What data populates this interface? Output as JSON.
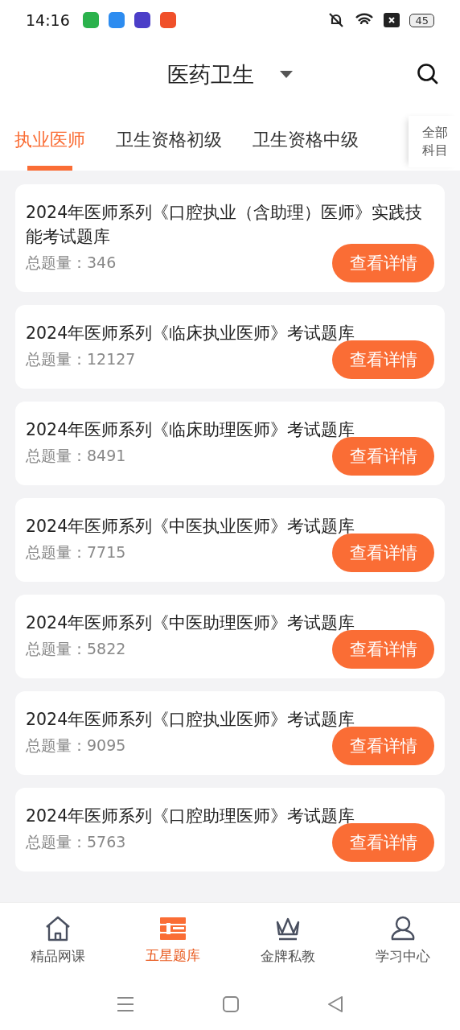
{
  "status_bar": {
    "time": "14:16",
    "battery": "45"
  },
  "header": {
    "title": "医药卫生"
  },
  "tabs": [
    {
      "label": "执业医师",
      "selected": true
    },
    {
      "label": "卫生资格初级",
      "selected": false
    },
    {
      "label": "卫生资格中级",
      "selected": false
    }
  ],
  "all_subjects": "全部科目",
  "banks": [
    {
      "title": "2024年医师系列《口腔执业（含助理）医师》实践技能考试题库",
      "count_label": "总题量：",
      "count": "346",
      "button": "查看详情"
    },
    {
      "title": "2024年医师系列《临床执业医师》考试题库",
      "count_label": "总题量：",
      "count": "12127",
      "button": "查看详情"
    },
    {
      "title": "2024年医师系列《临床助理医师》考试题库",
      "count_label": "总题量：",
      "count": "8491",
      "button": "查看详情"
    },
    {
      "title": "2024年医师系列《中医执业医师》考试题库",
      "count_label": "总题量：",
      "count": "7715",
      "button": "查看详情"
    },
    {
      "title": "2024年医师系列《中医助理医师》考试题库",
      "count_label": "总题量：",
      "count": "5822",
      "button": "查看详情"
    },
    {
      "title": "2024年医师系列《口腔执业医师》考试题库",
      "count_label": "总题量：",
      "count": "9095",
      "button": "查看详情"
    },
    {
      "title": "2024年医师系列《口腔助理医师》考试题库",
      "count_label": "总题量：",
      "count": "5763",
      "button": "查看详情"
    }
  ],
  "bottom_nav": [
    {
      "kind": "home",
      "label": "精品网课",
      "selected": false
    },
    {
      "kind": "bank",
      "label": "五星题库",
      "selected": true
    },
    {
      "kind": "crown",
      "label": "金牌私教",
      "selected": false
    },
    {
      "kind": "person",
      "label": "学习中心",
      "selected": false
    }
  ]
}
